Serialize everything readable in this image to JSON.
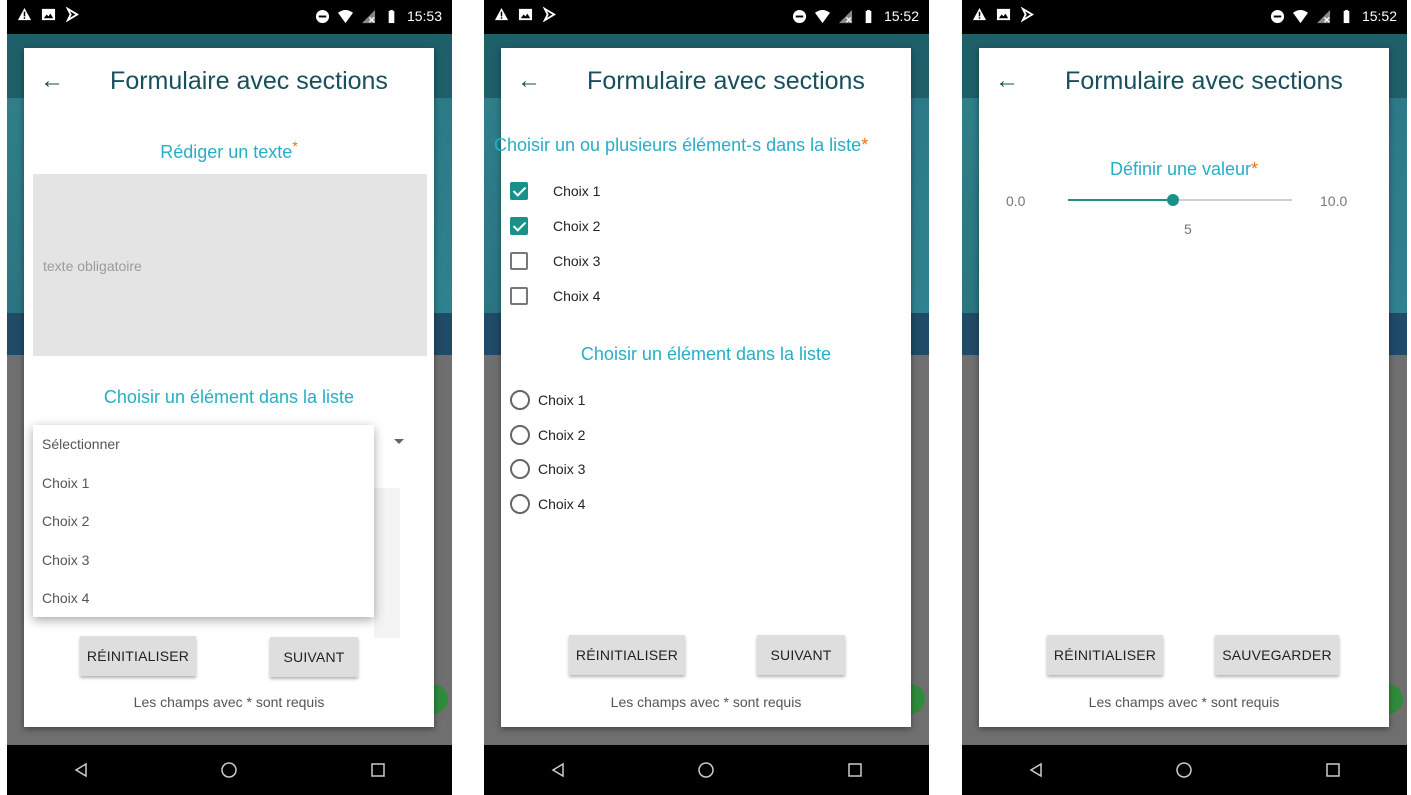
{
  "screens": [
    {
      "status_time": "15:53",
      "header_title": "Formulaire avec sections",
      "section_text_title": "Rédiger un texte",
      "required_mark": "*",
      "textarea_placeholder": "texte obligatoire",
      "section_select_title": "Choisir un élément dans la liste",
      "dropdown_options": [
        "Sélectionner",
        "Choix 1",
        "Choix 2",
        "Choix 3",
        "Choix 4"
      ],
      "reset_label": "RÉINITIALISER",
      "next_label": "SUIVANT",
      "footer_note": "Les champs avec * sont requis"
    },
    {
      "status_time": "15:52",
      "header_title": "Formulaire avec sections",
      "section_multi_title": "Choisir un ou plusieurs élément-s dans la liste",
      "required_mark": "*",
      "checkboxes": [
        {
          "label": "Choix 1",
          "checked": true
        },
        {
          "label": "Choix 2",
          "checked": true
        },
        {
          "label": "Choix 3",
          "checked": false
        },
        {
          "label": "Choix 4",
          "checked": false
        }
      ],
      "section_single_title": "Choisir un élément dans la liste",
      "radios": [
        "Choix 1",
        "Choix 2",
        "Choix 3",
        "Choix 4"
      ],
      "reset_label": "RÉINITIALISER",
      "next_label": "SUIVANT"
    },
    {
      "status_time": "15:52",
      "header_title": "Formulaire avec sections",
      "section_value_title": "Définir une valeur",
      "required_mark": "*",
      "slider": {
        "min": "0.0",
        "max": "10.0",
        "value": "5",
        "fraction": 0.47
      },
      "reset_label": "RÉINITIALISER",
      "save_label": "SAUVEGARDER",
      "footer_note": "Les champs avec * sont requis"
    }
  ],
  "icons": {
    "status_left": [
      "warning-icon",
      "image-icon",
      "download-icon"
    ],
    "status_right": [
      "do-not-disturb-icon",
      "wifi-icon",
      "no-signal-icon",
      "battery-icon"
    ],
    "nav": [
      "back-nav-icon",
      "home-nav-icon",
      "recents-nav-icon"
    ]
  },
  "colors": {
    "accent": "#17918a",
    "section_title": "#25aec5",
    "header_title": "#17505c",
    "required": "#f26b1d"
  }
}
